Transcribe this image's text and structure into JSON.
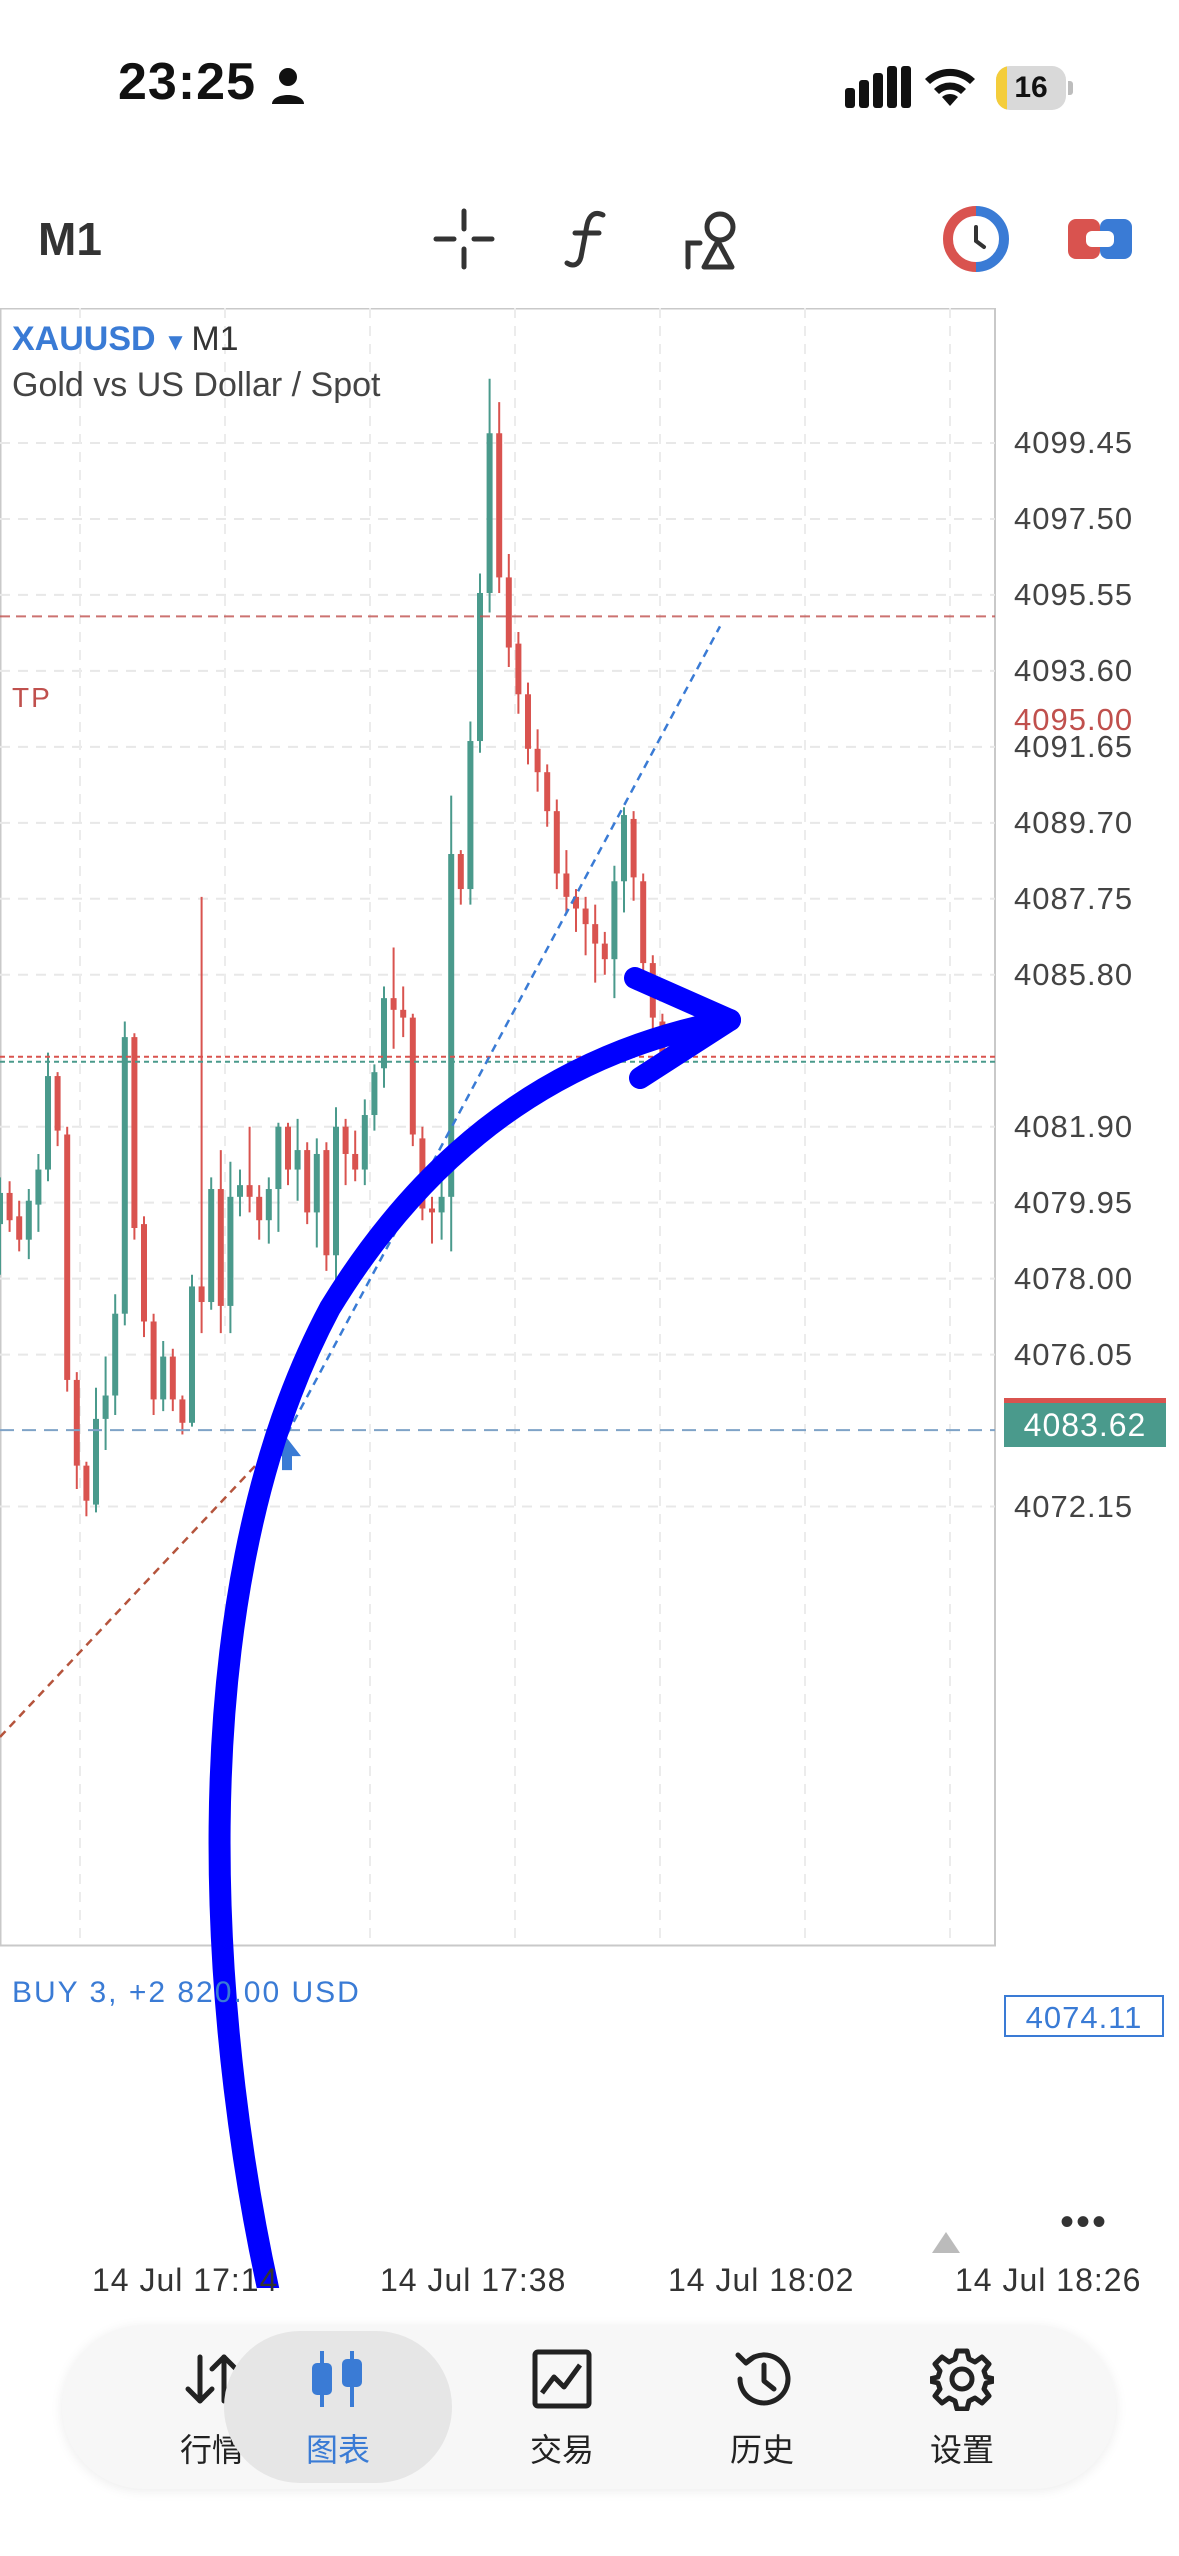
{
  "status_bar": {
    "time": "23:25",
    "battery_level": "16",
    "battery_fraction": 0.16
  },
  "toolbar": {
    "period": "M1",
    "icons": [
      "crosshair-icon",
      "indicator-f-icon",
      "objects-icon",
      "one-click-trading-icon",
      "trade-panel-icon"
    ]
  },
  "chart": {
    "symbol": "XAUUSD",
    "period": "M1",
    "description": "Gold vs US Dollar / Spot",
    "price_labels": [
      "4099.45",
      "4097.50",
      "4095.55",
      "4093.60",
      "4091.65",
      "4089.70",
      "4087.75",
      "4085.80",
      "4081.90",
      "4079.95",
      "4078.00",
      "4076.05",
      "4072.15"
    ],
    "tp_label": "TP",
    "tp_price": "4095.00",
    "current_price": "4083.62",
    "buy_label": "BUY 3, +2 820.00 USD",
    "buy_price": "4074.11",
    "time_labels": [
      "14 Jul 17:14",
      "14 Jul 17:38",
      "14 Jul 18:02",
      "14 Jul 18:26"
    ],
    "colors": {
      "bull": "#4a9a8c",
      "bear": "#d9534f",
      "accent": "#3a7bd5",
      "tp": "#c0504d",
      "annotation": "#0000ff"
    }
  },
  "chart_data": {
    "type": "candlestick",
    "title": "XAUUSD M1",
    "ylim": [
      4070.6,
      4101.0
    ],
    "y_ticks": [
      4099.45,
      4097.5,
      4095.55,
      4093.6,
      4091.65,
      4089.7,
      4087.75,
      4085.8,
      4081.9,
      4079.95,
      4078.0,
      4076.05,
      4072.15
    ],
    "x_tick_labels": [
      "14 Jul 17:14",
      "14 Jul 17:38",
      "14 Jul 18:02",
      "14 Jul 18:26"
    ],
    "levels": {
      "take_profit": 4095.0,
      "current": 4083.62,
      "entry": 4074.11
    },
    "candles_ohlc": [
      [
        4079.4,
        4080.6,
        4078.1,
        4080.2
      ],
      [
        4080.2,
        4080.5,
        4079.2,
        4079.5
      ],
      [
        4079.6,
        4080.0,
        4078.7,
        4079.0
      ],
      [
        4079.0,
        4080.3,
        4078.5,
        4080.0
      ],
      [
        4079.9,
        4081.2,
        4079.2,
        4080.8
      ],
      [
        4080.8,
        4083.8,
        4080.5,
        4083.2
      ],
      [
        4083.2,
        4083.3,
        4081.4,
        4081.8
      ],
      [
        4081.7,
        4081.9,
        4075.1,
        4075.4
      ],
      [
        4075.4,
        4075.6,
        4072.6,
        4073.2
      ],
      [
        4073.2,
        4073.3,
        4071.9,
        4072.3
      ],
      [
        4072.2,
        4075.2,
        4072.0,
        4074.4
      ],
      [
        4074.4,
        4076.0,
        4073.6,
        4075.0
      ],
      [
        4075.0,
        4077.6,
        4074.5,
        4077.1
      ],
      [
        4077.1,
        4084.6,
        4076.8,
        4084.2
      ],
      [
        4084.2,
        4084.3,
        4079.0,
        4079.3
      ],
      [
        4079.4,
        4079.6,
        4076.5,
        4076.9
      ],
      [
        4076.9,
        4077.1,
        4074.5,
        4074.9
      ],
      [
        4074.9,
        4076.4,
        4074.6,
        4076.0
      ],
      [
        4076.0,
        4076.2,
        4074.6,
        4074.9
      ],
      [
        4074.9,
        4075.0,
        4074.0,
        4074.3
      ],
      [
        4074.3,
        4078.1,
        4074.2,
        4077.8
      ],
      [
        4077.8,
        4087.8,
        4076.6,
        4077.4
      ],
      [
        4077.4,
        4080.6,
        4077.2,
        4080.3
      ],
      [
        4080.3,
        4081.3,
        4076.6,
        4077.3
      ],
      [
        4077.3,
        4081.0,
        4076.6,
        4080.1
      ],
      [
        4080.1,
        4080.8,
        4079.6,
        4080.4
      ],
      [
        4080.4,
        4081.9,
        4079.7,
        4080.1
      ],
      [
        4080.1,
        4080.4,
        4079.0,
        4079.5
      ],
      [
        4079.5,
        4080.6,
        4078.9,
        4080.3
      ],
      [
        4080.3,
        4082.0,
        4079.2,
        4081.9
      ],
      [
        4081.9,
        4082.0,
        4080.4,
        4080.8
      ],
      [
        4080.8,
        4082.1,
        4080.0,
        4081.3
      ],
      [
        4081.3,
        4081.5,
        4079.4,
        4079.7
      ],
      [
        4079.7,
        4081.6,
        4078.8,
        4081.2
      ],
      [
        4081.3,
        4081.5,
        4078.2,
        4078.6
      ],
      [
        4078.6,
        4082.4,
        4077.9,
        4081.9
      ],
      [
        4081.9,
        4082.1,
        4080.4,
        4081.2
      ],
      [
        4081.2,
        4081.8,
        4080.5,
        4080.8
      ],
      [
        4080.8,
        4082.6,
        4080.4,
        4082.2
      ],
      [
        4082.2,
        4083.5,
        4081.8,
        4083.3
      ],
      [
        4083.4,
        4085.5,
        4082.9,
        4085.2
      ],
      [
        4085.2,
        4086.5,
        4083.9,
        4084.9
      ],
      [
        4084.9,
        4085.5,
        4084.2,
        4084.7
      ],
      [
        4084.7,
        4084.8,
        4081.4,
        4081.7
      ],
      [
        4081.6,
        4081.9,
        4079.5,
        4079.8
      ],
      [
        4079.8,
        4080.1,
        4078.9,
        4079.7
      ],
      [
        4079.7,
        4080.5,
        4079.0,
        4080.1
      ],
      [
        4080.1,
        4090.4,
        4078.7,
        4088.9
      ],
      [
        4088.9,
        4089.0,
        4087.6,
        4088.0
      ],
      [
        4088.0,
        4092.3,
        4087.6,
        4091.8
      ],
      [
        4091.8,
        4096.1,
        4091.5,
        4095.6
      ],
      [
        4095.6,
        4101.1,
        4095.1,
        4099.7
      ],
      [
        4099.7,
        4100.5,
        4095.6,
        4096.0
      ],
      [
        4096.0,
        4096.6,
        4093.7,
        4094.2
      ],
      [
        4094.3,
        4094.6,
        4092.5,
        4093.0
      ],
      [
        4093.0,
        4093.3,
        4091.2,
        4091.6
      ],
      [
        4091.6,
        4092.1,
        4090.5,
        4091.0
      ],
      [
        4091.0,
        4091.2,
        4089.6,
        4090.0
      ],
      [
        4090.0,
        4090.3,
        4088.0,
        4088.4
      ],
      [
        4088.4,
        4089.0,
        4087.4,
        4087.8
      ],
      [
        4087.8,
        4088.0,
        4086.9,
        4087.5
      ],
      [
        4087.5,
        4087.8,
        4086.3,
        4087.1
      ],
      [
        4087.1,
        4087.6,
        4085.6,
        4086.6
      ],
      [
        4086.6,
        4086.9,
        4085.8,
        4086.2
      ],
      [
        4086.2,
        4088.6,
        4085.2,
        4088.2
      ],
      [
        4088.2,
        4090.1,
        4087.4,
        4089.9
      ],
      [
        4089.8,
        4090.0,
        4087.7,
        4088.3
      ],
      [
        4088.2,
        4088.4,
        4085.5,
        4086.1
      ],
      [
        4086.1,
        4086.3,
        4083.9,
        4084.7
      ],
      [
        4084.6,
        4084.8,
        4083.3,
        4083.6
      ]
    ]
  },
  "bottom_nav": {
    "items": [
      {
        "label": "行情",
        "icon": "quotes-icon"
      },
      {
        "label": "图表",
        "icon": "chart-icon",
        "active": true
      },
      {
        "label": "交易",
        "icon": "trade-icon"
      },
      {
        "label": "历史",
        "icon": "history-icon"
      },
      {
        "label": "设置",
        "icon": "settings-icon"
      }
    ]
  }
}
